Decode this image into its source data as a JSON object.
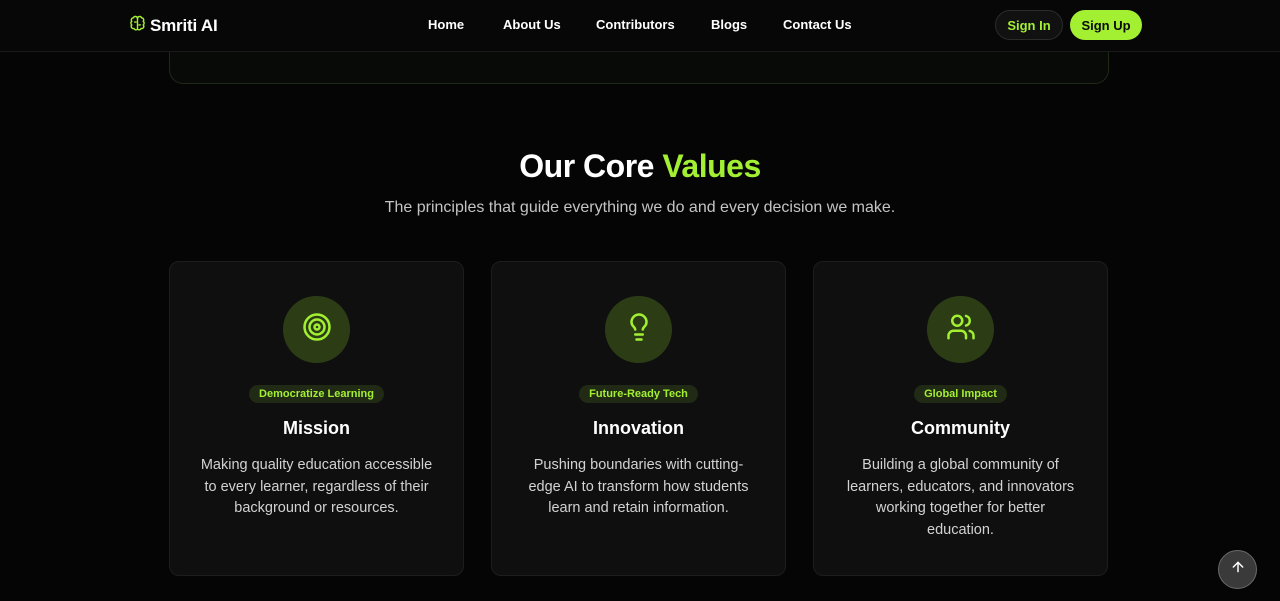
{
  "navbar": {
    "brand": {
      "name": "Smriti AI",
      "icon": "brain-icon"
    },
    "links": [
      {
        "label": "Home"
      },
      {
        "label": "About Us"
      },
      {
        "label": "Contributors"
      },
      {
        "label": "Blogs"
      },
      {
        "label": "Contact Us"
      }
    ],
    "sign_in_label": "Sign In",
    "sign_up_label": "Sign Up"
  },
  "section": {
    "title_main": "Our Core",
    "title_accent": "Values",
    "subtitle": "The principles that guide everything we do and every decision we make."
  },
  "cards": [
    {
      "icon": "target-icon",
      "badge": "Democratize Learning",
      "title": "Mission",
      "description": "Making quality education accessible to every learner, regardless of their background or resources."
    },
    {
      "icon": "lightbulb-icon",
      "badge": "Future-Ready Tech",
      "title": "Innovation",
      "description": "Pushing boundaries with cutting-edge AI to transform how students learn and retain information."
    },
    {
      "icon": "users-icon",
      "badge": "Global Impact",
      "title": "Community",
      "description": "Building a global community of learners, educators, and innovators working together for better education."
    }
  ],
  "scroll_top": {
    "icon": "arrow-up-icon"
  },
  "colors": {
    "accent": "#a3f033",
    "background": "#050505",
    "card": "#0f0f0f",
    "icon_circle": "#2c3d16"
  }
}
